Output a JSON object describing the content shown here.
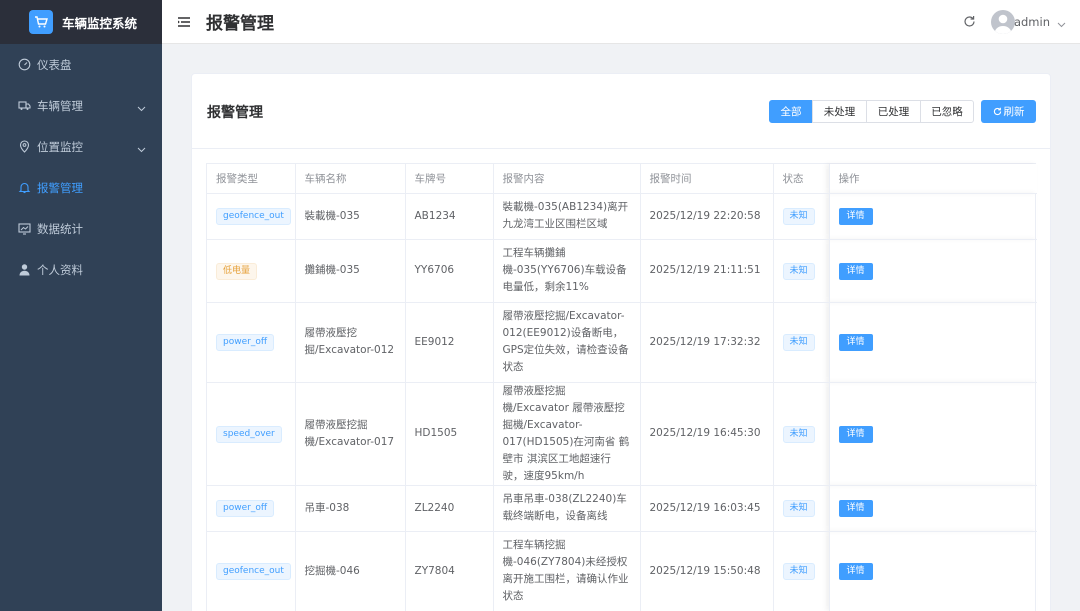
{
  "brand": {
    "title": "车辆监控系统",
    "logo_icon": "cart-icon"
  },
  "sidebar": {
    "items": [
      {
        "label": "仪表盘",
        "icon": "dashboard-icon"
      },
      {
        "label": "车辆管理",
        "icon": "truck-icon",
        "has_submenu": true
      },
      {
        "label": "位置监控",
        "icon": "location-icon",
        "has_submenu": true
      },
      {
        "label": "报警管理",
        "icon": "bell-icon",
        "active": true
      },
      {
        "label": "数据统计",
        "icon": "chart-icon"
      },
      {
        "label": "个人资料",
        "icon": "user-icon"
      }
    ]
  },
  "header": {
    "title": "报警管理",
    "username": "admin"
  },
  "card": {
    "title": "报警管理",
    "filters": [
      {
        "label": "全部",
        "active": true
      },
      {
        "label": "未处理"
      },
      {
        "label": "已处理"
      },
      {
        "label": "已忽略"
      }
    ],
    "refresh_label": "刷新"
  },
  "table": {
    "columns": [
      "报警类型",
      "车辆名称",
      "车牌号",
      "报警内容",
      "报警时间",
      "状态",
      "操作"
    ],
    "rows": [
      {
        "type": "geofence_out",
        "vehicle": "裝載機-035",
        "plate": "AB1234",
        "content": "裝載機-035(AB1234)离开九龙湾工业区围栏区域",
        "time": "2025/12/19 22:20:58",
        "status": "未知",
        "action": "详情"
      },
      {
        "type": "低电量",
        "vehicle": "攤鋪機-035",
        "plate": "YY6706",
        "content": "工程车辆攤鋪機-035(YY6706)车载设备电量低，剩余11%",
        "time": "2025/12/19 21:11:51",
        "status": "未知",
        "action": "详情"
      },
      {
        "type": "power_off",
        "vehicle": "履帶液壓挖掘/Excavator-012",
        "plate": "EE9012",
        "content": "履帶液壓挖掘/Excavator-012(EE9012)设备断电，GPS定位失效，请检查设备状态",
        "time": "2025/12/19 17:32:32",
        "status": "未知",
        "action": "详情"
      },
      {
        "type": "speed_over",
        "vehicle": "履帶液壓挖掘機/Excavator-017",
        "plate": "HD1505",
        "content": "履帶液壓挖掘機/Excavator 履帶液壓挖掘機/Excavator-017(HD1505)在河南省 鹤壁市 淇滨区工地超速行驶，速度95km/h",
        "time": "2025/12/19 16:45:30",
        "status": "未知",
        "action": "详情"
      },
      {
        "type": "power_off",
        "vehicle": "吊車-038",
        "plate": "ZL2240",
        "content": "吊車吊車-038(ZL2240)车载终端断电，设备离线",
        "time": "2025/12/19 16:03:45",
        "status": "未知",
        "action": "详情"
      },
      {
        "type": "geofence_out",
        "vehicle": "挖掘機-046",
        "plate": "ZY7804",
        "content": "工程车辆挖掘機-046(ZY7804)未经授权离开施工围栏，请确认作业状态",
        "time": "2025/12/19 15:50:48",
        "status": "未知",
        "action": "详情"
      }
    ]
  },
  "colors": {
    "sidebar_bg": "#304156",
    "brand_bg": "#2b2f3a",
    "accent": "#409eff",
    "warning": "#e6a23c"
  }
}
